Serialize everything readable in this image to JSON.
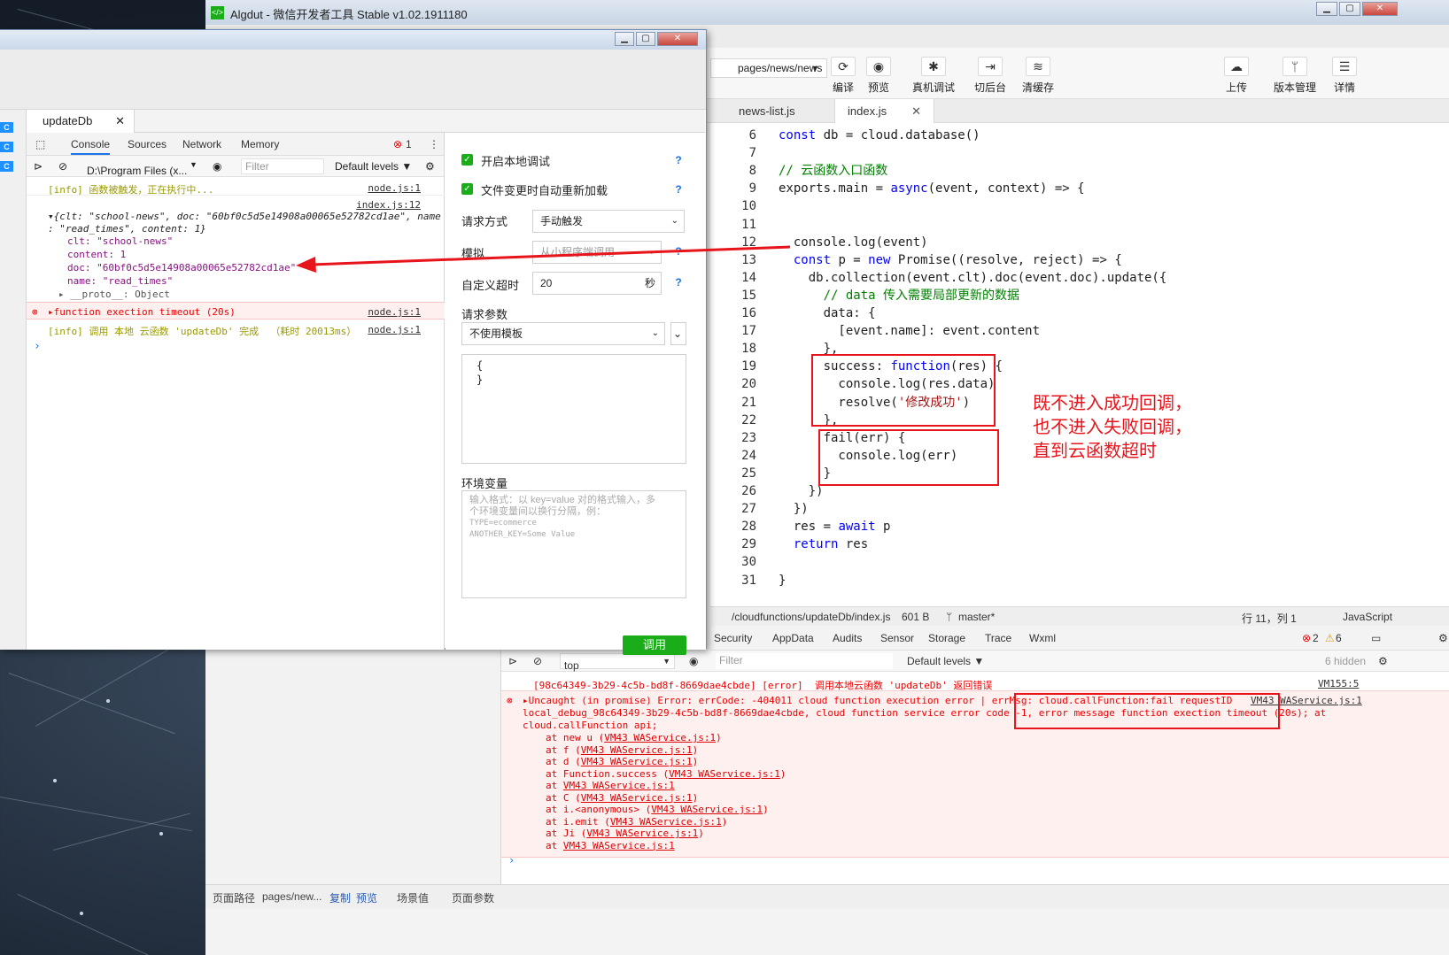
{
  "main_window": {
    "title": "Algdut - 微信开发者工具 Stable v1.02.1911180",
    "page_path": "pages/news/news",
    "toolbar": [
      {
        "label": "编译",
        "icon": "refresh-icon"
      },
      {
        "label": "预览",
        "icon": "eye-icon"
      },
      {
        "label": "真机调试",
        "icon": "bug-icon"
      },
      {
        "label": "切后台",
        "icon": "switch-background-icon"
      },
      {
        "label": "清缓存",
        "icon": "layers-icon"
      },
      {
        "label": "上传",
        "icon": "cloud-upload-icon"
      },
      {
        "label": "版本管理",
        "icon": "branch-icon"
      },
      {
        "label": "详情",
        "icon": "menu-icon"
      }
    ]
  },
  "editor": {
    "tabs": [
      "news-list.js",
      "index.js"
    ],
    "lines": [
      {
        "n": "6",
        "t": "const db = cloud.database()"
      },
      {
        "n": "7",
        "t": ""
      },
      {
        "n": "8",
        "t": "// 云函数入口函数"
      },
      {
        "n": "9",
        "t": "exports.main = async(event, context) => {"
      },
      {
        "n": "10",
        "t": ""
      },
      {
        "n": "11",
        "t": ""
      },
      {
        "n": "12",
        "t": "  console.log(event)"
      },
      {
        "n": "13",
        "t": "  const p = new Promise((resolve, reject) => {"
      },
      {
        "n": "14",
        "t": "    db.collection(event.clt).doc(event.doc).update({"
      },
      {
        "n": "15",
        "t": "      // data 传入需要局部更新的数据"
      },
      {
        "n": "16",
        "t": "      data: {"
      },
      {
        "n": "17",
        "t": "        [event.name]: event.content"
      },
      {
        "n": "18",
        "t": "      },"
      },
      {
        "n": "19",
        "t": "      success: function(res) {"
      },
      {
        "n": "20",
        "t": "        console.log(res.data)"
      },
      {
        "n": "21",
        "t": "        resolve('修改成功')"
      },
      {
        "n": "22",
        "t": "      },"
      },
      {
        "n": "23",
        "t": "      fail(err) {"
      },
      {
        "n": "24",
        "t": "        console.log(err)"
      },
      {
        "n": "25",
        "t": "      }"
      },
      {
        "n": "26",
        "t": "    })"
      },
      {
        "n": "27",
        "t": "  })"
      },
      {
        "n": "28",
        "t": "  res = await p"
      },
      {
        "n": "29",
        "t": "  return res"
      },
      {
        "n": "30",
        "t": ""
      },
      {
        "n": "31",
        "t": "}"
      }
    ],
    "status": {
      "path": "/cloudfunctions/updateDb/index.js",
      "size": "601 B",
      "branch": "master*",
      "cursor": "行 11，列 1",
      "language": "JavaScript"
    }
  },
  "annotation": {
    "text": "既不进入成功回调，\n也不进入失败回调，\n直到云函数超时"
  },
  "bottom_devtools": {
    "tabs": [
      "Security",
      "AppData",
      "Audits",
      "Sensor",
      "Storage",
      "Trace",
      "Wxml"
    ],
    "error_count": "2",
    "warning_count": "6",
    "context": "top",
    "filter_placeholder": "Filter",
    "levels": "Default levels ▼",
    "hidden": "6 hidden",
    "log_error_line": "[98c64349-3b29-4c5b-bd8f-8669dae4cbde] [error]  调用本地云函数 'updateDb' 返回错误",
    "log_error_src": "VM155:5",
    "uncaught_lines": [
      "▸Uncaught (in promise) Error: errCode: -404011 cloud function execution error | errMsg: cloud.callFunction:fail requestID",
      "local_debug_98c64349-3b29-4c5b-bd8f-8669dae4cbde, cloud function service error code -1, error message function exection timeout (20s); at",
      "cloud.callFunction api;"
    ],
    "uncaught_src": "VM43 WAService.js:1",
    "stack": [
      {
        "pre": "at new u (",
        "link": "VM43 WAService.js:1",
        "post": ")"
      },
      {
        "pre": "at f (",
        "link": "VM43 WAService.js:1",
        "post": ")"
      },
      {
        "pre": "at d (",
        "link": "VM43 WAService.js:1",
        "post": ")"
      },
      {
        "pre": "at Function.success (",
        "link": "VM43 WAService.js:1",
        "post": ")"
      },
      {
        "pre": "at ",
        "link": "VM43 WAService.js:1",
        "post": ""
      },
      {
        "pre": "at C (",
        "link": "VM43 WAService.js:1",
        "post": ")"
      },
      {
        "pre": "at i.<anonymous> (",
        "link": "VM43 WAService.js:1",
        "post": ")"
      },
      {
        "pre": "at i.emit (",
        "link": "VM43 WAService.js:1",
        "post": ")"
      },
      {
        "pre": "at Ji (",
        "link": "VM43 WAService.js:1",
        "post": ")"
      },
      {
        "pre": "at ",
        "link": "VM43 WAService.js:1",
        "post": ""
      }
    ]
  },
  "sim_footer": {
    "path_label": "页面路径",
    "path_value": "pages/new...",
    "copy": "复制",
    "preview": "预览",
    "scene": "场景值",
    "params": "页面参数"
  },
  "debug_window": {
    "tab": "updateDb",
    "console_tabs": [
      "Console",
      "Sources",
      "Network",
      "Memory"
    ],
    "error_count": "1",
    "path_select": "D:\\Program Files (x...",
    "filter_placeholder": "Filter",
    "levels": "Default levels ▼",
    "log": {
      "info1": "[info] 函数被触发，正在执行中...",
      "info1_src": "node.js:1",
      "obj_src": "index.js:12",
      "obj_summary_1": "▾{clt: \"school-news\", doc: \"60bf0c5d5e14908a00065e52782cd1ae\", name",
      "obj_summary_2": ": \"read_times\", content: 1}",
      "props": [
        "clt: \"school-news\"",
        "content: 1",
        "doc: \"60bf0c5d5e14908a00065e52782cd1ae\"",
        "name: \"read_times\"",
        "▸ __proto__: Object"
      ],
      "err": "▸function exection timeout (20s)",
      "err_src": "node.js:1",
      "info2": "[info] 调用 本地 云函数 'updateDb' 完成  （耗时 20013ms）",
      "info2_src": "node.js:1"
    },
    "cf": {
      "local_debug": "开启本地调试",
      "auto_reload": "文件变更时自动重新加载",
      "request_mode_label": "请求方式",
      "request_mode": "手动触发",
      "simulate_label": "模拟",
      "simulate": "从小程序端调用",
      "timeout_label": "自定义超时",
      "timeout_value": "20",
      "timeout_unit": "秒",
      "params_label": "请求参数",
      "template": "不使用模板",
      "params_body": "{\n}",
      "env_label": "环境变量",
      "env_placeholder_1": "输入格式：以 key=value 对的格式输入，多",
      "env_placeholder_2": "个环境变量间以换行分隔，例：",
      "env_example_1": "TYPE=ecommerce",
      "env_example_2": "ANOTHER_KEY=Some Value",
      "invoke": "调用"
    }
  }
}
